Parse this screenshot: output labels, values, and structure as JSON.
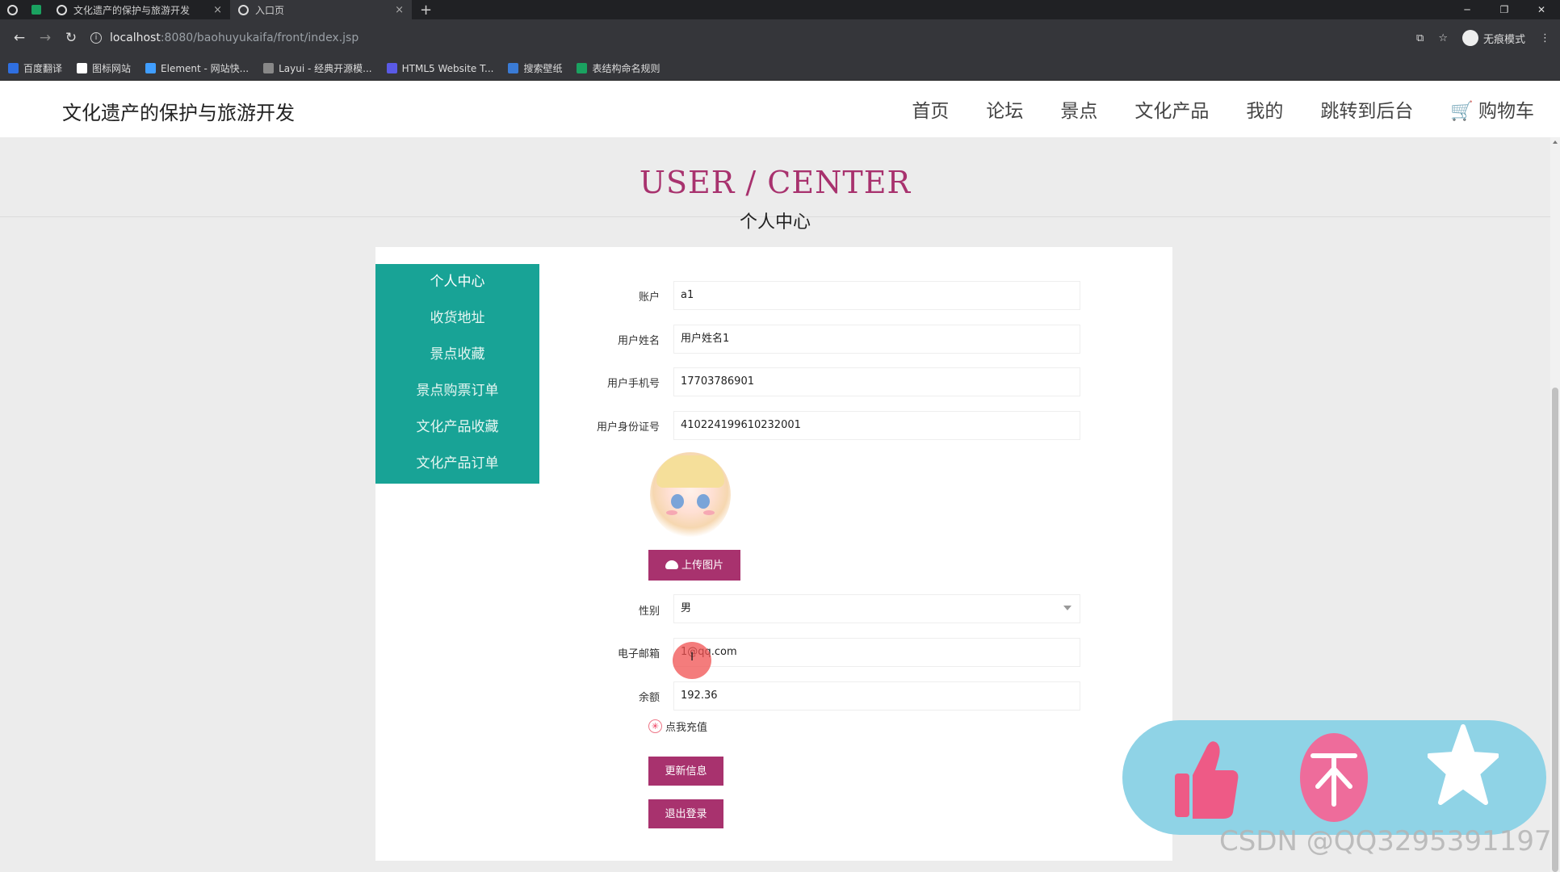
{
  "browser": {
    "tabs": [
      {
        "title": "文化遗产的保护与旅游开发",
        "close": "×"
      },
      {
        "title": "入口页",
        "close": "×"
      }
    ],
    "new_tab": "+",
    "window_controls": {
      "minimize": "─",
      "restore": "❐",
      "close": "✕"
    },
    "url_host": "localhost",
    "url_rest": ":8080/baohuyukaifa/front/index.jsp",
    "incognito_label": "无痕模式",
    "bookmarks": [
      {
        "label": "百度翻译",
        "color": "#2f6fe0"
      },
      {
        "label": "图标网站",
        "color": "#ffffff"
      },
      {
        "label": "Element - 网站快...",
        "color": "#409eff"
      },
      {
        "label": "Layui - 经典开源模...",
        "color": "#888888"
      },
      {
        "label": "HTML5 Website T...",
        "color": "#5a5ae6"
      },
      {
        "label": "搜索壁纸",
        "color": "#3a7bd5"
      },
      {
        "label": "表结构命名规则",
        "color": "#1aa260"
      }
    ]
  },
  "site": {
    "title": "文化遗产的保护与旅游开发",
    "nav": [
      "首页",
      "论坛",
      "景点",
      "文化产品",
      "我的",
      "跳转到后台",
      "购物车"
    ]
  },
  "page": {
    "en_title": "USER / CENTER",
    "cn_title": "个人中心"
  },
  "sidebar": {
    "items": [
      "个人中心",
      "收货地址",
      "景点收藏",
      "景点购票订单",
      "文化产品收藏",
      "文化产品订单"
    ]
  },
  "form": {
    "account": {
      "label": "账户",
      "value": "a1"
    },
    "name": {
      "label": "用户姓名",
      "value": "用户姓名1"
    },
    "phone": {
      "label": "用户手机号",
      "value": "17703786901"
    },
    "idcard": {
      "label": "用户身份证号",
      "value": "410224199610232001"
    },
    "upload_label": "上传图片",
    "gender": {
      "label": "性别",
      "value": "男"
    },
    "email": {
      "label": "电子邮箱",
      "value": "1@qq.com"
    },
    "balance": {
      "label": "余额",
      "value": "192.36"
    },
    "recharge_label": "点我充值",
    "update_label": "更新信息",
    "logout_label": "退出登录"
  },
  "watermark": "CSDN @QQ3295391197",
  "colors": {
    "accent": "#a8326e",
    "sidebar": "#18a396",
    "float_bar": "#8fd3e6",
    "float_circle": "#ee6c9b"
  }
}
